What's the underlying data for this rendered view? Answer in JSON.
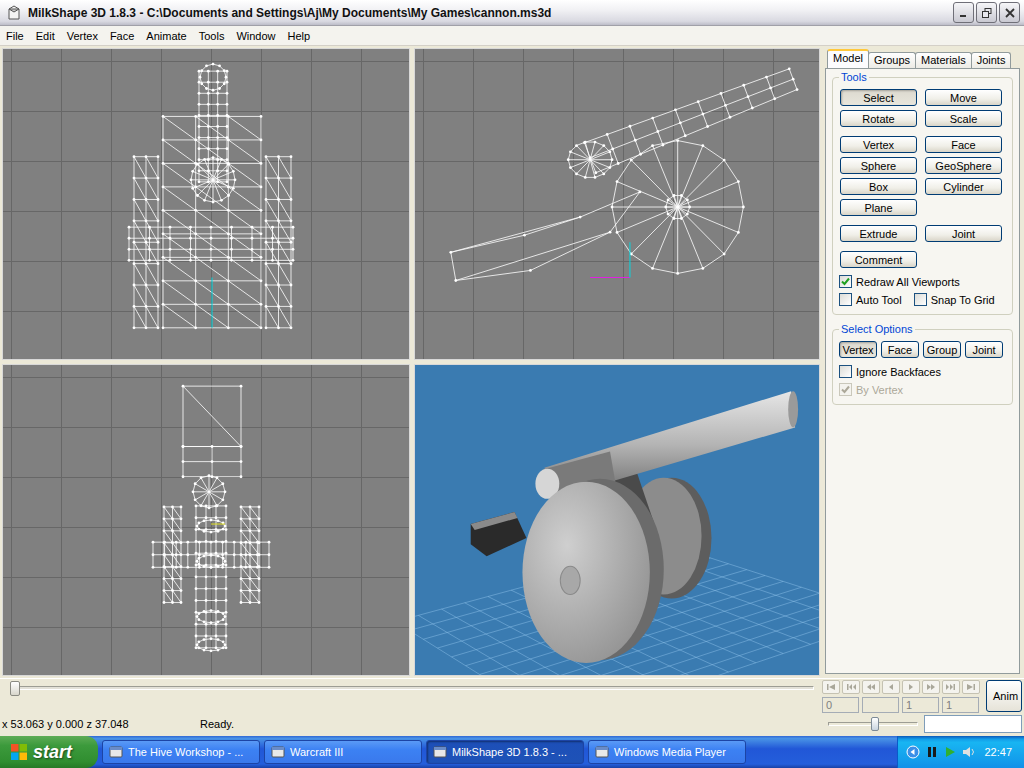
{
  "window": {
    "title": "MilkShape 3D 1.8.3 - C:\\Documents and Settings\\Aj\\My Documents\\My Games\\cannon.ms3d"
  },
  "menu": [
    "File",
    "Edit",
    "Vertex",
    "Face",
    "Animate",
    "Tools",
    "Window",
    "Help"
  ],
  "tabs": [
    {
      "label": "Model",
      "selected": true
    },
    {
      "label": "Groups",
      "selected": false
    },
    {
      "label": "Materials",
      "selected": false
    },
    {
      "label": "Joints",
      "selected": false
    }
  ],
  "tools": {
    "label": "Tools",
    "groups": [
      {
        "buttons": [
          {
            "label": "Select",
            "selected": true
          },
          {
            "label": "Move",
            "selected": false
          },
          {
            "label": "Rotate",
            "selected": false
          },
          {
            "label": "Scale",
            "selected": false
          }
        ]
      },
      {
        "buttons": [
          {
            "label": "Vertex",
            "selected": false
          },
          {
            "label": "Face",
            "selected": false
          },
          {
            "label": "Sphere",
            "selected": false
          },
          {
            "label": "GeoSphere",
            "selected": false
          },
          {
            "label": "Box",
            "selected": false
          },
          {
            "label": "Cylinder",
            "selected": false
          },
          {
            "label": "Plane",
            "selected": false
          }
        ]
      },
      {
        "buttons": [
          {
            "label": "Extrude",
            "selected": false
          },
          {
            "label": "Joint",
            "selected": false
          }
        ]
      },
      {
        "buttons": [
          {
            "label": "Comment",
            "selected": false
          }
        ]
      }
    ],
    "options": [
      {
        "items": [
          {
            "label": "Redraw All Viewports",
            "checked": true,
            "disabled": false
          }
        ]
      },
      {
        "items": [
          {
            "label": "Auto Tool",
            "checked": false,
            "disabled": false
          },
          {
            "label": "Snap To Grid",
            "checked": false,
            "disabled": false
          }
        ]
      }
    ]
  },
  "select_options": {
    "label": "Select Options",
    "buttons": [
      {
        "label": "Vertex",
        "selected": true
      },
      {
        "label": "Face",
        "selected": false
      },
      {
        "label": "Group",
        "selected": false
      },
      {
        "label": "Joint",
        "selected": false
      }
    ],
    "options": [
      {
        "label": "Ignore Backfaces",
        "checked": false,
        "disabled": false
      },
      {
        "label": "By Vertex",
        "checked": true,
        "disabled": true
      }
    ]
  },
  "timeline": {
    "level": 0,
    "transport_enabled": false,
    "fields": [
      {
        "value": "0",
        "disabled": true
      },
      {
        "value": "",
        "disabled": true
      },
      {
        "value": "1",
        "disabled": true
      },
      {
        "value": "1",
        "disabled": true
      }
    ],
    "anim_button": "Anim"
  },
  "status_bar": {
    "coords": "x 53.063 y 0.000 z 37.048",
    "message": "Ready.",
    "speed_level": 0.48,
    "field": ""
  },
  "taskbar": {
    "start": "start",
    "tasks": [
      {
        "label": "The Hive Workshop - ...",
        "selected": false
      },
      {
        "label": "Warcraft III",
        "selected": false
      },
      {
        "label": "MilkShape 3D 1.8.3 - ...",
        "selected": true
      },
      {
        "label": "Windows Media Player",
        "selected": false
      }
    ],
    "clock": "22:47"
  }
}
